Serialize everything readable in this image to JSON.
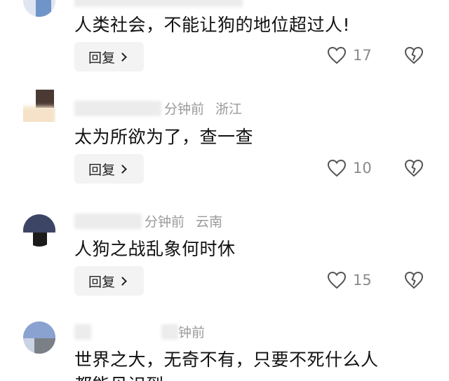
{
  "comments": [
    {
      "meta": "",
      "location": "",
      "text": "人类社会，不能让狗的地位超过人!",
      "reply_label": "回复",
      "likes": "17"
    },
    {
      "meta": "分钟前",
      "location": "浙江",
      "text": "太为所欲为了，查一查",
      "reply_label": "回复",
      "likes": "10"
    },
    {
      "meta": "分钟前",
      "location": "云南",
      "text": "人狗之战乱象何时休",
      "reply_label": "回复",
      "likes": "15"
    },
    {
      "meta": "钟前",
      "location": "",
      "text": "世界之大，无奇不有，只要不死什么人",
      "text2": "都能见识到"
    }
  ],
  "icons": {
    "like": "heart-outline-icon",
    "dislike": "broken-heart-icon"
  },
  "colors": {
    "text": "#111111",
    "meta": "#9a9a9a",
    "reply_bg": "#f3f3f3"
  }
}
